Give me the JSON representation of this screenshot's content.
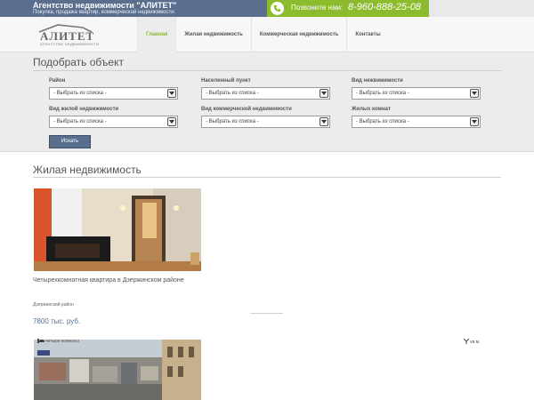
{
  "topbar": {
    "agency_title": "Агентство недвижимости \"АЛИТЕТ\"",
    "agency_subtitle": "Покупка, продажа квартир, коммерческой недвижимости.",
    "call_label": "Позвоните нам:",
    "phone": "8-960-888-25-08"
  },
  "logo": {
    "name": "АЛИТЕТ",
    "tagline": "АГЕНТСТВО НЕДВИЖИМОСТИ"
  },
  "nav": {
    "items": [
      {
        "label": "Главная",
        "active": true
      },
      {
        "label": "Жилая недвижимость",
        "active": false
      },
      {
        "label": "Коммерческая недвижимость",
        "active": false
      },
      {
        "label": "Контакты",
        "active": false
      }
    ]
  },
  "search": {
    "title": "Подобрать объект",
    "fields": [
      {
        "label": "Район",
        "value": "- Выбрать из списка -"
      },
      {
        "label": "Населенный пункт",
        "value": "- Выбрать из списка -"
      },
      {
        "label": "Вид нежвижимости",
        "value": "- Выбрать из списка -"
      },
      {
        "label": "Вид жилой недвижимости",
        "value": "- Выбрать из списка -"
      },
      {
        "label": "Вид коммерческой недвижимости",
        "value": "- Выбрать из списка -"
      },
      {
        "label": "Жилых комнат",
        "value": "- Выбрать из списка -"
      }
    ],
    "button_label": "Искать"
  },
  "listings": {
    "section_title": "Жилая недвижимость",
    "items": [
      {
        "title": "Четырехкомнатная квартира в Дзержинском районе",
        "district": "Дзержинский район",
        "price": "7800 тыс. руб."
      },
      {
        "rooms": "четыре комнаты",
        "area": "кв.м."
      }
    ]
  },
  "colors": {
    "brand_blue": "#5a6e8e",
    "accent_green": "#8cbb2e",
    "panel_gray": "#ececec"
  }
}
